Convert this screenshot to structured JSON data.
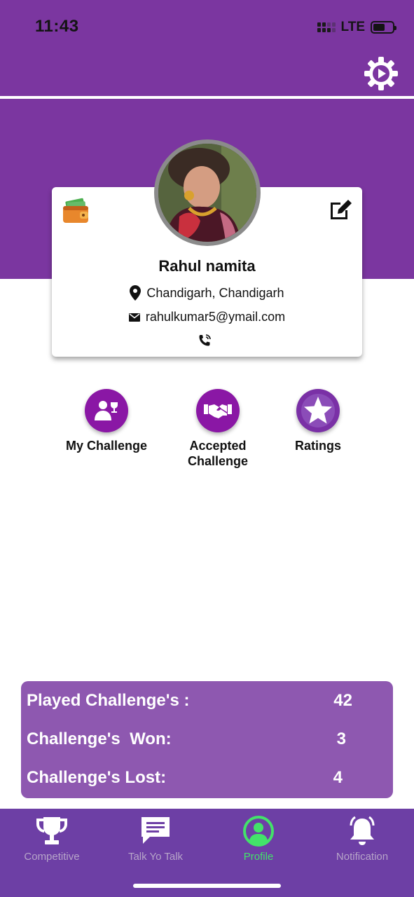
{
  "status_bar": {
    "time": "11:43",
    "network": "LTE"
  },
  "header": {
    "settings_icon": "gear-icon"
  },
  "profile": {
    "name": "Rahul namita",
    "location": "Chandigarh, Chandigarh",
    "email": "rahulkumar5@ymail.com",
    "wallet_icon": "wallet-icon",
    "edit_icon": "edit-icon",
    "phone_icon": "phone-icon"
  },
  "actions": [
    {
      "label": "My Challenge",
      "icon": "users-trophy-icon"
    },
    {
      "label": "Accepted Challenge",
      "icon": "handshake-icon"
    },
    {
      "label": "Ratings",
      "icon": "star-icon"
    }
  ],
  "stats": [
    {
      "label": "Played Challenge's :",
      "value": "42"
    },
    {
      "label": "Challenge's  Won:",
      "value": "3"
    },
    {
      "label": "Challenge's Lost:",
      "value": "4"
    }
  ],
  "nav": [
    {
      "label": "Competitive",
      "icon": "trophy-icon",
      "active": false
    },
    {
      "label": "Talk Yo Talk",
      "icon": "chat-icon",
      "active": false
    },
    {
      "label": "Profile",
      "icon": "profile-icon",
      "active": true
    },
    {
      "label": "Notification",
      "icon": "bell-icon",
      "active": false
    }
  ],
  "colors": {
    "header_purple": "#7b36a0",
    "action_purple": "#8a17a5",
    "stats_bg": "#8e58b0",
    "nav_bg": "#6d3fa5",
    "nav_active": "#43e26a"
  }
}
